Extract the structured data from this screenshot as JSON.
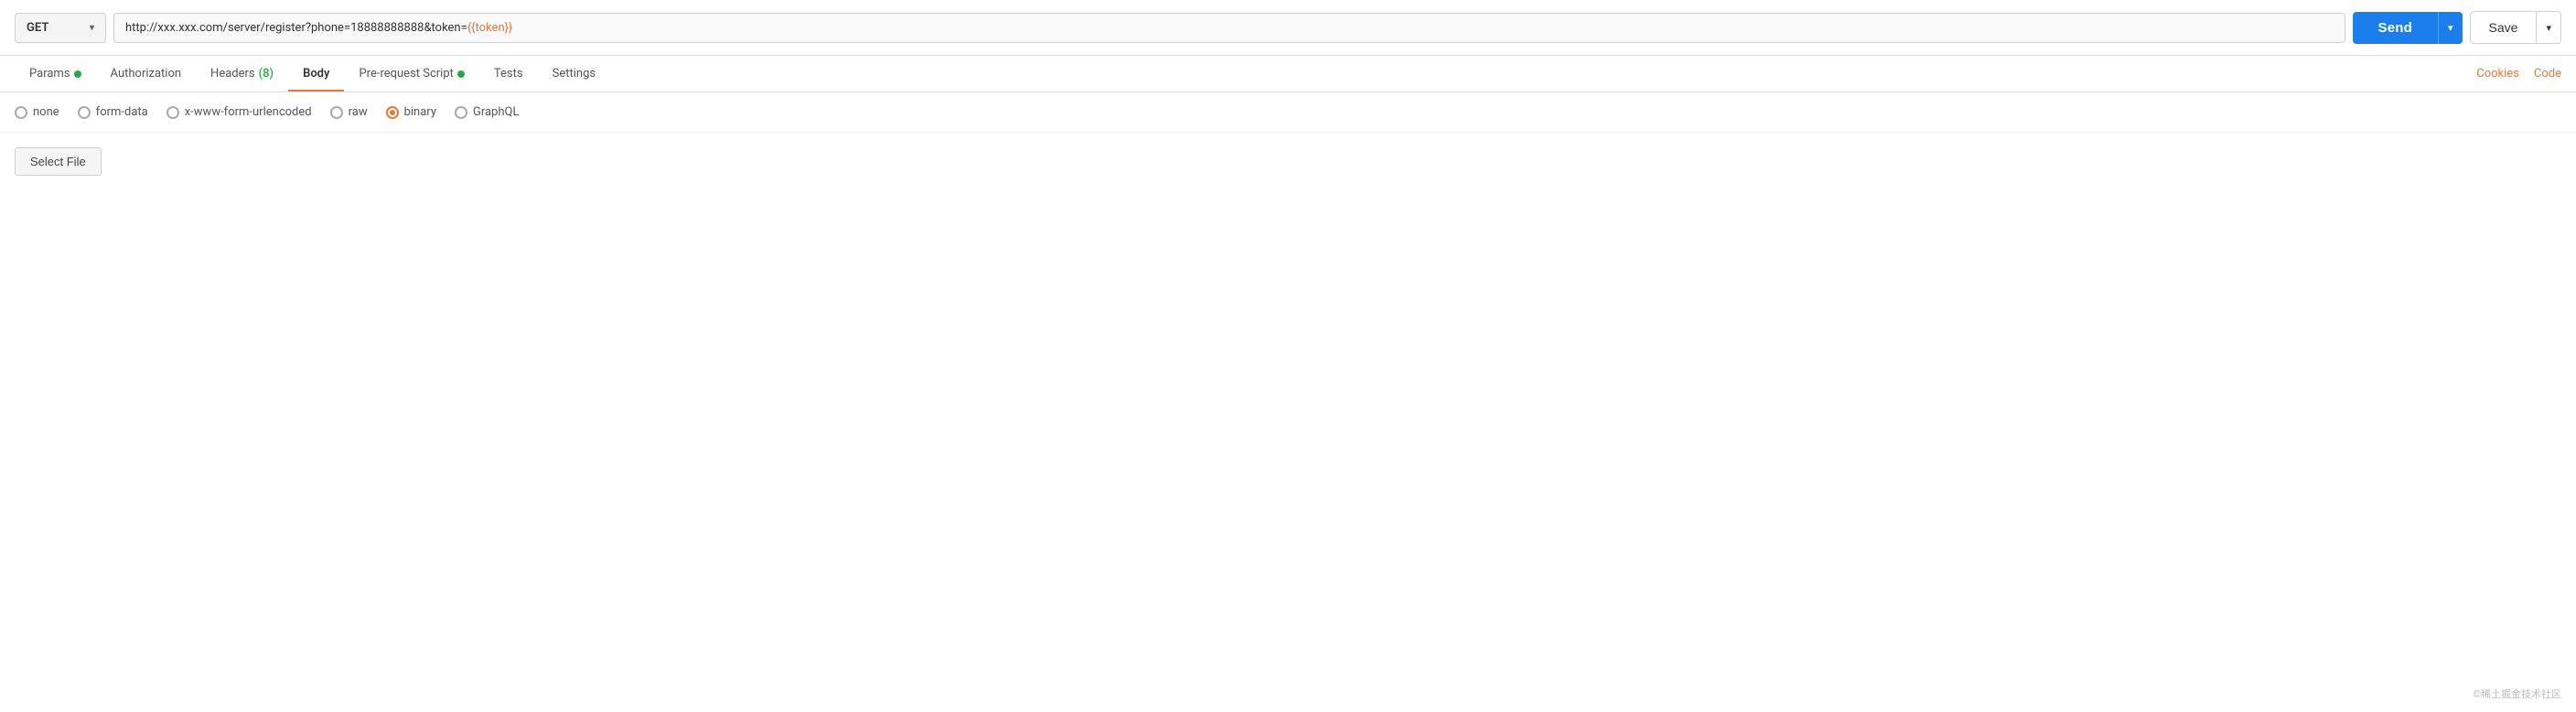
{
  "topbar": {
    "method": "GET",
    "method_chevron": "▾",
    "url_prefix": "http://xxx.xxx.com/server/register?phone=18888888888&token=",
    "url_template": "{{token}}",
    "send_label": "Send",
    "send_chevron": "▾",
    "save_label": "Save",
    "save_chevron": "▾"
  },
  "tabs": {
    "items": [
      {
        "id": "params",
        "label": "Params",
        "badge": "",
        "dot": "green",
        "active": false
      },
      {
        "id": "authorization",
        "label": "Authorization",
        "badge": "",
        "dot": "",
        "active": false
      },
      {
        "id": "headers",
        "label": "Headers",
        "badge": "(8)",
        "dot": "",
        "active": false
      },
      {
        "id": "body",
        "label": "Body",
        "badge": "",
        "dot": "",
        "active": true
      },
      {
        "id": "prerequest",
        "label": "Pre-request Script",
        "badge": "",
        "dot": "green",
        "active": false
      },
      {
        "id": "tests",
        "label": "Tests",
        "badge": "",
        "dot": "",
        "active": false
      },
      {
        "id": "settings",
        "label": "Settings",
        "badge": "",
        "dot": "",
        "active": false
      }
    ],
    "right_links": [
      {
        "id": "cookies",
        "label": "Cookies"
      },
      {
        "id": "code",
        "label": "Code"
      }
    ]
  },
  "body_options": {
    "options": [
      {
        "id": "none",
        "label": "none",
        "selected": false
      },
      {
        "id": "form-data",
        "label": "form-data",
        "selected": false
      },
      {
        "id": "x-www-form-urlencoded",
        "label": "x-www-form-urlencoded",
        "selected": false
      },
      {
        "id": "raw",
        "label": "raw",
        "selected": false
      },
      {
        "id": "binary",
        "label": "binary",
        "selected": true
      },
      {
        "id": "graphql",
        "label": "GraphQL",
        "selected": false
      }
    ],
    "select_file_label": "Select File"
  },
  "footer": {
    "watermark": "©稀土掘金技术社区"
  }
}
